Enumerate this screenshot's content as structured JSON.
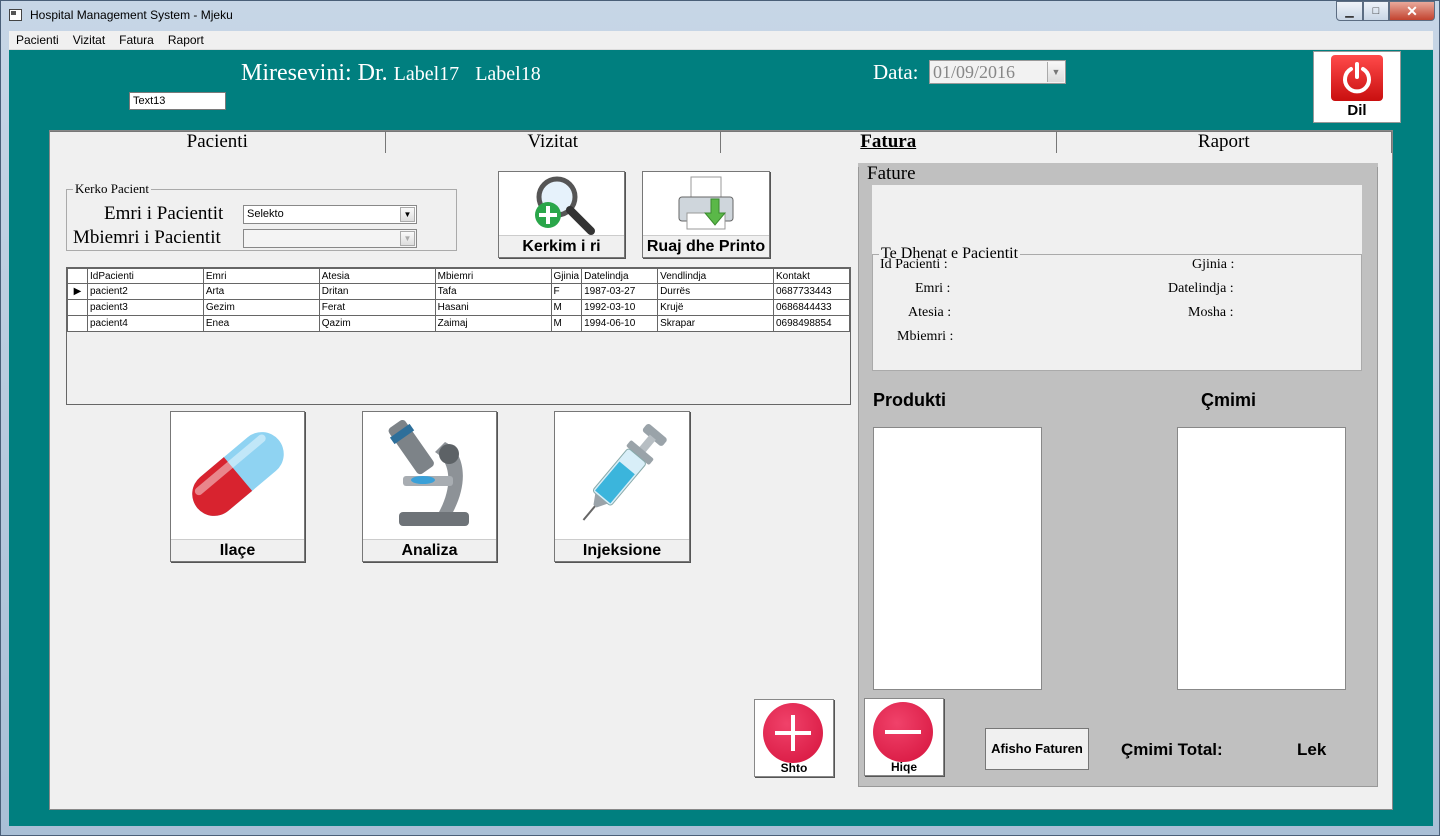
{
  "window": {
    "title": "Hospital Management System - Mjeku"
  },
  "menu": [
    "Pacienti",
    "Vizitat",
    "Fatura",
    "Raport"
  ],
  "header": {
    "welcome_text": "Miresevini: Dr.",
    "label17": "Label17",
    "label18": "Label18",
    "text13": "Text13",
    "data_label": "Data:",
    "data_value": "01/09/2016",
    "dil_label": "Dil"
  },
  "tabs": [
    "Pacienti",
    "Vizitat",
    "Fatura",
    "Raport"
  ],
  "search": {
    "legend": "Kerko Pacient",
    "emri_label": "Emri i Pacientit",
    "emri_value": "Selekto",
    "mbiemri_label": "Mbiemri i Pacientit",
    "mbiemri_value": ""
  },
  "buttons": {
    "kerkim": "Kerkim i ri",
    "ruaj": "Ruaj dhe Printo",
    "ilace": "Ilaçe",
    "analiza": "Analiza",
    "injeksione": "Injeksione",
    "shto": "Shto",
    "hiqe": "Hiqe",
    "afisho": "Afisho Faturen"
  },
  "grid": {
    "columns": [
      "IdPacienti",
      "Emri",
      "Atesia",
      "Mbiemri",
      "Gjinia",
      "Datelindja",
      "Vendlindja",
      "Kontakt"
    ],
    "rows": [
      [
        "pacient2",
        "Arta",
        "Dritan",
        "Tafa",
        "F",
        "1987-03-27",
        "Durrës",
        "0687733443"
      ],
      [
        "pacient3",
        "Gezim",
        "Ferat",
        "Hasani",
        "M",
        "1992-03-10",
        "Krujë",
        "0686844433"
      ],
      [
        "pacient4",
        "Enea",
        "Qazim",
        "Zaimaj",
        "M",
        "1994-06-10",
        "Skrapar",
        "0698498854"
      ]
    ]
  },
  "fatura": {
    "title": "Fature",
    "dhenat_legend": "Te Dhenat e Pacientit",
    "id_label": "Id Pacienti :",
    "emri_label": "Emri :",
    "atesia_label": "Atesia :",
    "mbiemri_label": "Mbiemri :",
    "gjinia_label": "Gjinia :",
    "datelindja_label": "Datelindja :",
    "mosha_label": "Mosha :",
    "produkti": "Produkti",
    "cmimi": "Çmimi",
    "total_label": "Çmimi Total:",
    "currency": "Lek"
  }
}
